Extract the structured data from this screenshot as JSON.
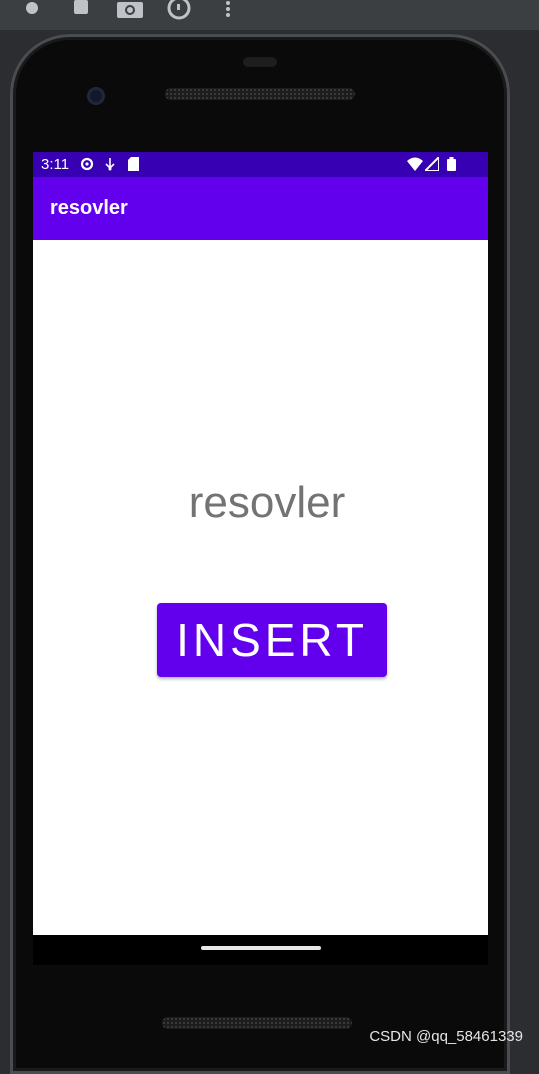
{
  "toolbar": {
    "icons": [
      "record-icon",
      "stop-icon",
      "camera-icon",
      "rotate-icon",
      "more-icon"
    ]
  },
  "status_bar": {
    "time": "3:11",
    "left_icons": [
      "settings-icon",
      "usb-icon",
      "sd-card-icon"
    ],
    "right_icons": [
      "wifi-icon",
      "signal-icon",
      "battery-icon"
    ],
    "color": "#3700b3"
  },
  "app_bar": {
    "title": "resovler",
    "color": "#6200ee"
  },
  "main": {
    "text": "resovler",
    "button_label": "INSERT",
    "button_color": "#6200ee"
  },
  "watermark": "CSDN @qq_58461339"
}
